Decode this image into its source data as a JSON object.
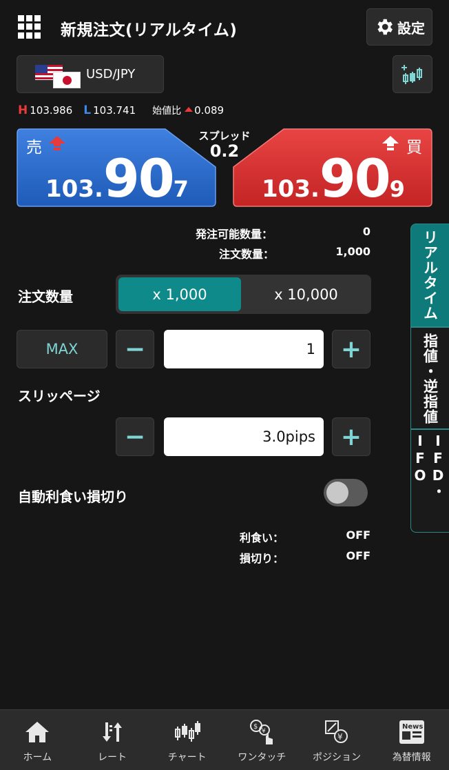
{
  "header": {
    "title": "新規注文(リアルタイム)",
    "settings_label": "設定"
  },
  "pair": {
    "label": "USD/JPY"
  },
  "rates": {
    "high_marker": "H",
    "high": "103.986",
    "low_marker": "L",
    "low": "103.741",
    "change_label": "始値比",
    "change": "0.089"
  },
  "sell": {
    "label": "売",
    "prefix": "103.",
    "big": "90",
    "pip": "7"
  },
  "buy": {
    "label": "買",
    "prefix": "103.",
    "big": "90",
    "pip": "9"
  },
  "spread": {
    "label": "スプレッド",
    "value": "0.2"
  },
  "order_info": {
    "available_label": "発注可能数量：",
    "available_value": "0",
    "quantity_label": "注文数量：",
    "quantity_value": "1,000"
  },
  "quantity": {
    "label": "注文数量",
    "unit_options": [
      "x 1,000",
      "x 10,000"
    ],
    "max_label": "MAX",
    "value": "1"
  },
  "slippage": {
    "label": "スリッページ",
    "value": "3.0pips"
  },
  "auto_limit": {
    "label": "自動利食い損切り",
    "take_profit_label": "利食い：",
    "take_profit_value": "OFF",
    "stop_loss_label": "損切り：",
    "stop_loss_value": "OFF"
  },
  "steppers": {
    "minus": "−",
    "plus": "+"
  },
  "side_tabs": [
    "リアルタイム",
    "指値・逆指値",
    "IFD・IFO"
  ],
  "nav": [
    {
      "label": "ホーム",
      "icon": "home-icon"
    },
    {
      "label": "レート",
      "icon": "rate-icon"
    },
    {
      "label": "チャート",
      "icon": "chart-icon"
    },
    {
      "label": "ワンタッチ",
      "icon": "one-touch-icon"
    },
    {
      "label": "ポジション",
      "icon": "position-icon"
    },
    {
      "label": "為替情報",
      "icon": "news-icon"
    }
  ],
  "nav_icon_text": {
    "news": "News"
  },
  "colors": {
    "sell": "#2f6fd0",
    "buy": "#e03a3a",
    "accent": "#0e8a8a",
    "background": "#161616"
  }
}
